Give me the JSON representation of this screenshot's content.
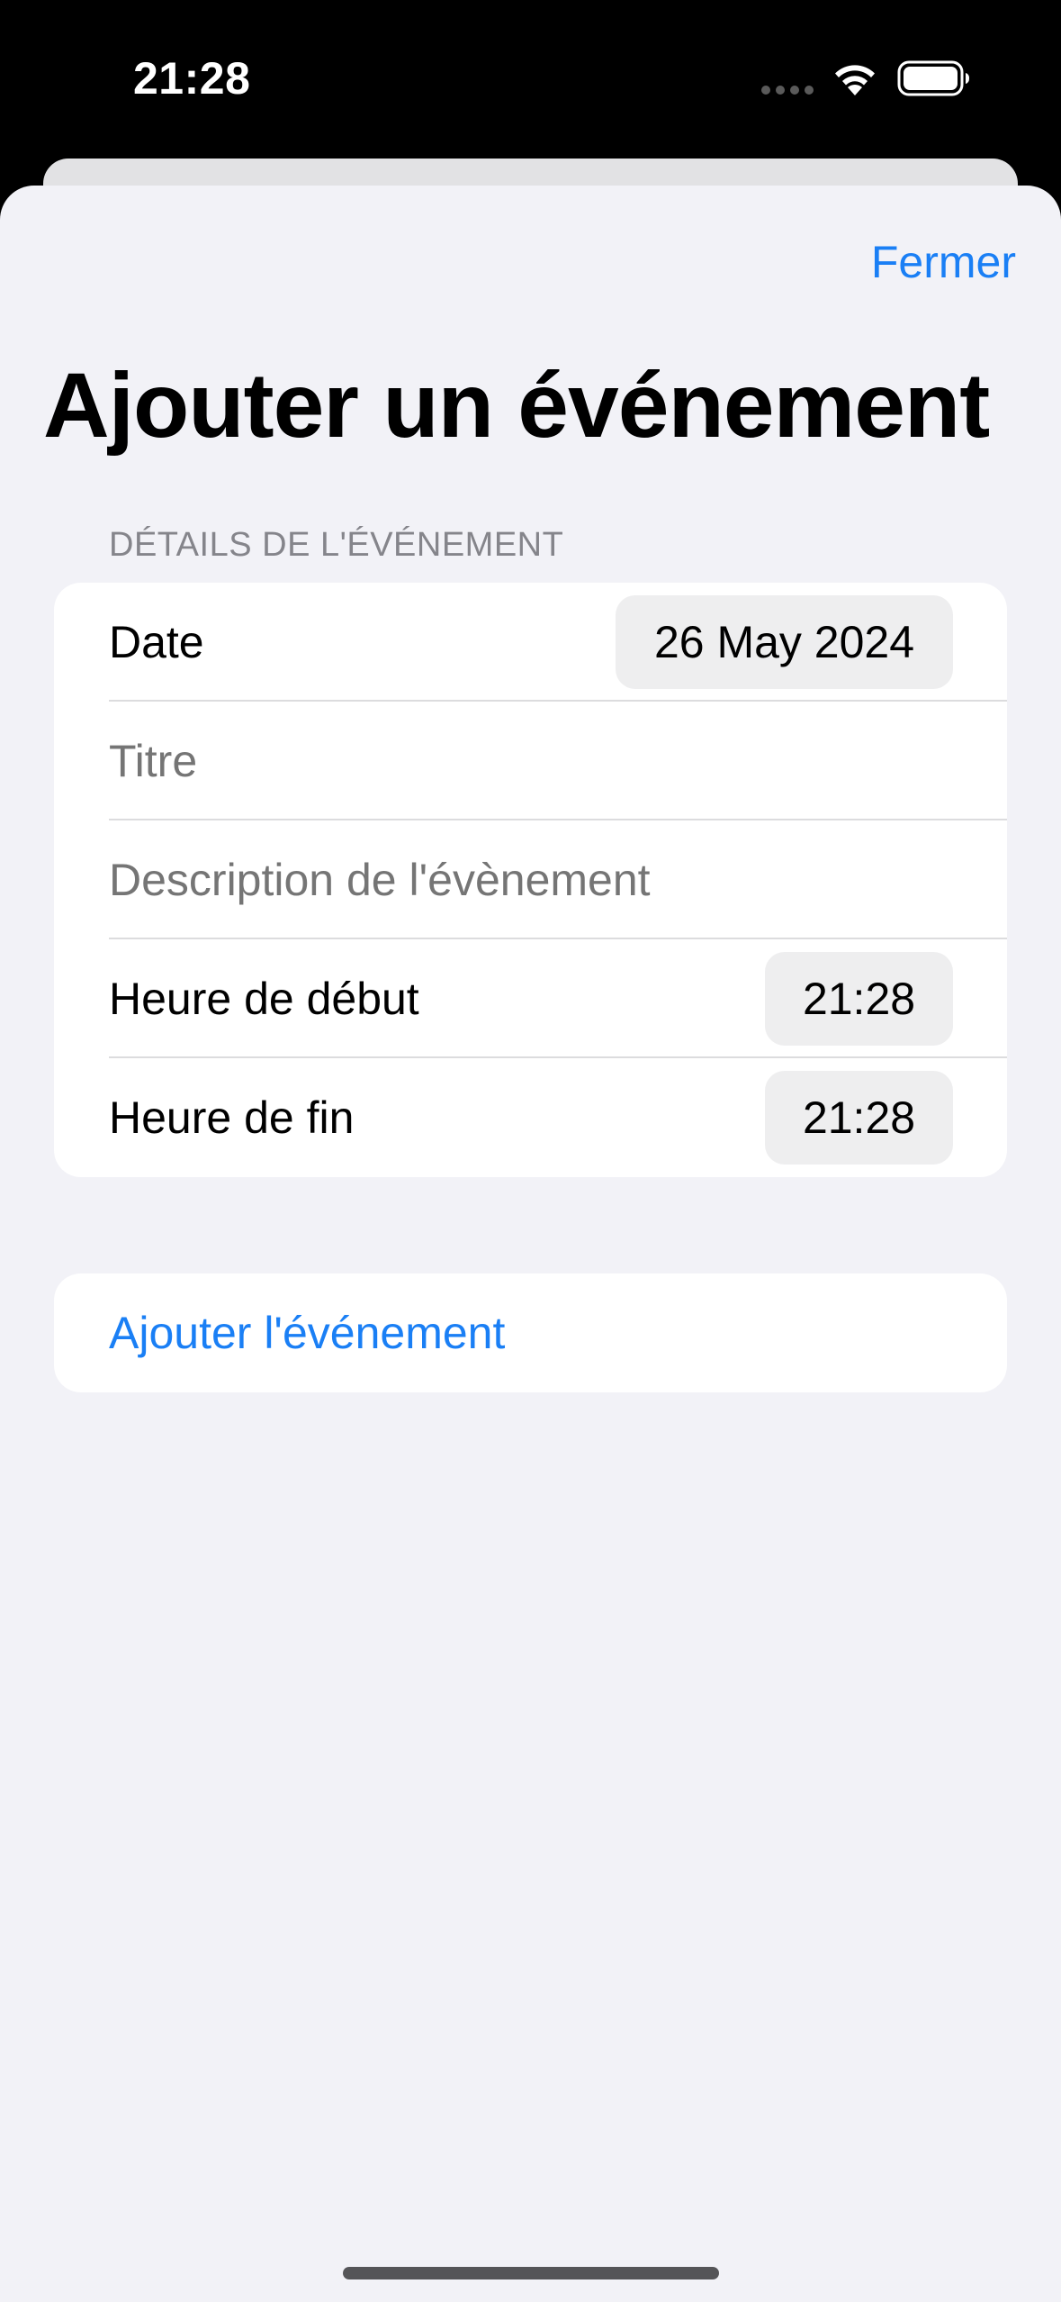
{
  "status_bar": {
    "time": "21:28"
  },
  "header": {
    "close_label": "Fermer",
    "title": "Ajouter un événement"
  },
  "form": {
    "section_header": "DÉTAILS DE L'ÉVÉNEMENT",
    "date_label": "Date",
    "date_value": "26 May 2024",
    "title_placeholder": "Titre",
    "description_placeholder": "Description de l'évènement",
    "start_label": "Heure de début",
    "start_value": "21:28",
    "end_label": "Heure de fin",
    "end_value": "21:28"
  },
  "actions": {
    "add_label": "Ajouter l'événement"
  },
  "colors": {
    "accent": "#1a7ff5",
    "sheet_background": "#f2f2f7",
    "card_background": "#ffffff",
    "placeholder": "#c4c4c6",
    "section_header": "#85858b"
  },
  "icons": [
    "cellular-dots-icon",
    "wifi-icon",
    "battery-icon"
  ]
}
